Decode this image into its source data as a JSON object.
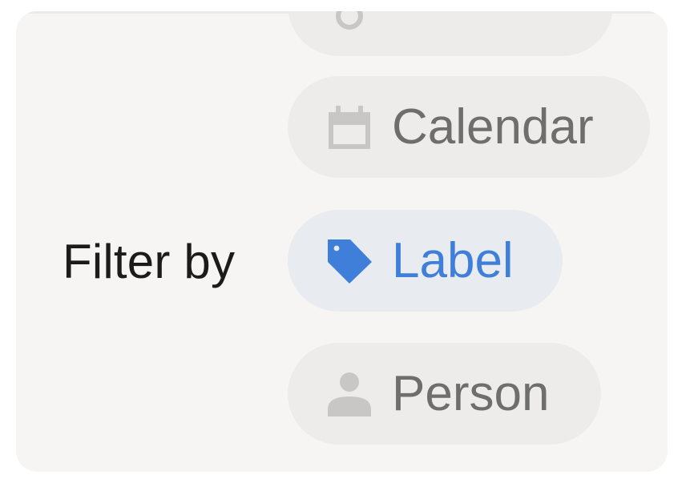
{
  "filter": {
    "label": "Filter by",
    "options": [
      {
        "label": "Calendar",
        "icon": "calendar-icon",
        "selected": false
      },
      {
        "label": "Label",
        "icon": "tag-icon",
        "selected": true
      },
      {
        "label": "Person",
        "icon": "person-icon",
        "selected": false
      }
    ]
  },
  "colors": {
    "panel_background": "#f6f5f3",
    "chip_background": "#edecea",
    "chip_selected_background": "#e8ebef",
    "chip_text": "#6e6e6c",
    "accent": "#3f7fd9",
    "icon_gray": "#c8c7c5"
  }
}
